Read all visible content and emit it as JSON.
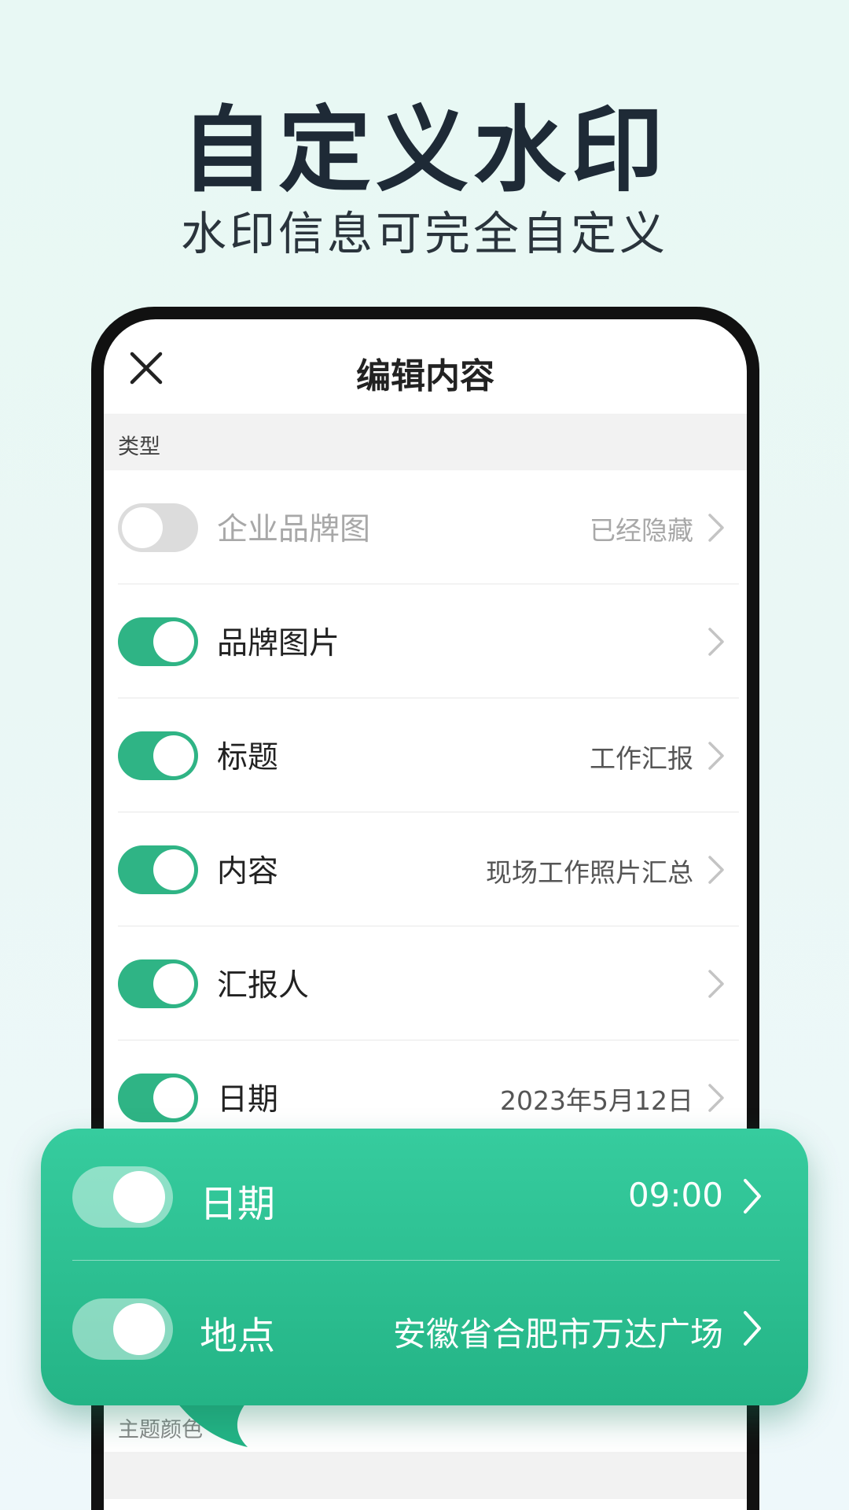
{
  "hero": {
    "title": "自定义水印",
    "subtitle": "水印信息可完全自定义"
  },
  "nav": {
    "title": "编辑内容",
    "close_icon": "close-icon"
  },
  "section": {
    "type_label": "类型",
    "theme_color_label": "主题颜色"
  },
  "rows": [
    {
      "label": "企业品牌图",
      "value": "已经隐藏",
      "enabled": false
    },
    {
      "label": "品牌图片",
      "value": "",
      "enabled": true
    },
    {
      "label": "标题",
      "value": "工作汇报",
      "enabled": true
    },
    {
      "label": "内容",
      "value": "现场工作照片汇总",
      "enabled": true
    },
    {
      "label": "汇报人",
      "value": "",
      "enabled": true
    },
    {
      "label": "日期",
      "value": "2023年5月12日",
      "enabled": true
    }
  ],
  "popup": {
    "rows": [
      {
        "label": "日期",
        "value": "09:00",
        "enabled": true
      },
      {
        "label": "地点",
        "value": "安徽省合肥市万达广场",
        "enabled": true
      }
    ]
  },
  "colors": {
    "accent": "#2fb485",
    "popup_top": "#36cc9e",
    "popup_bottom": "#24b486",
    "title_text": "#1e2a36"
  }
}
